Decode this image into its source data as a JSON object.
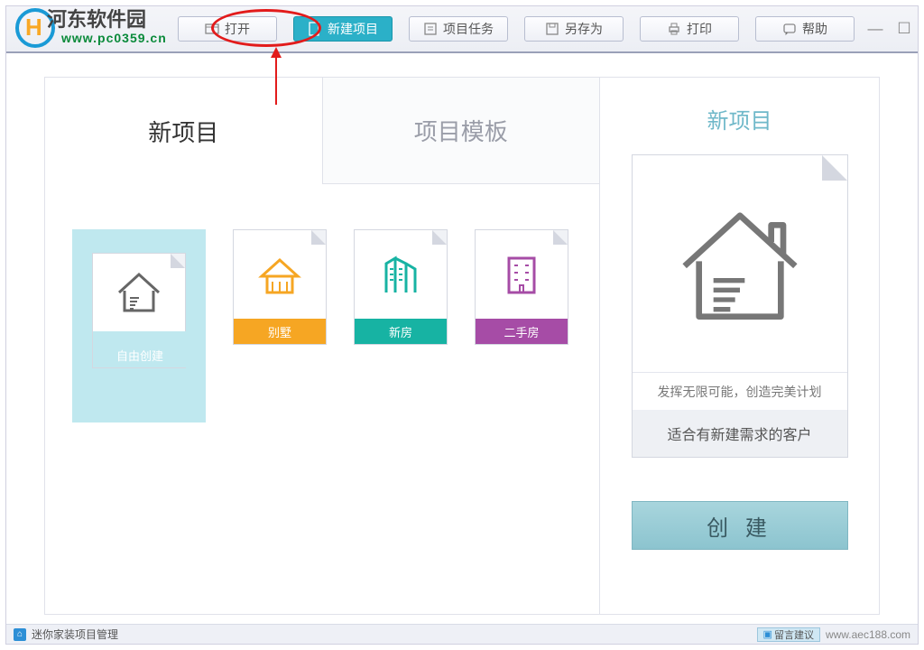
{
  "brand": {
    "name": "河东软件园",
    "url": "www.pc0359.cn"
  },
  "toolbar": {
    "buttons": [
      {
        "label": "打开"
      },
      {
        "label": "新建项目"
      },
      {
        "label": "项目任务"
      },
      {
        "label": "另存为"
      },
      {
        "label": "打印"
      },
      {
        "label": "帮助"
      }
    ]
  },
  "tabs": {
    "new_project": "新项目",
    "template": "项目模板"
  },
  "cards": {
    "free": "自由创建",
    "villa": "别墅",
    "new_house": "新房",
    "second_hand": "二手房"
  },
  "right": {
    "title": "新项目",
    "caption": "发挥无限可能，创造完美计划",
    "desc": "适合有新建需求的客户",
    "create": "创 建"
  },
  "status": {
    "app_name": "迷你家装项目管理",
    "feedback": "留言建议",
    "site": "www.aec188.com"
  }
}
